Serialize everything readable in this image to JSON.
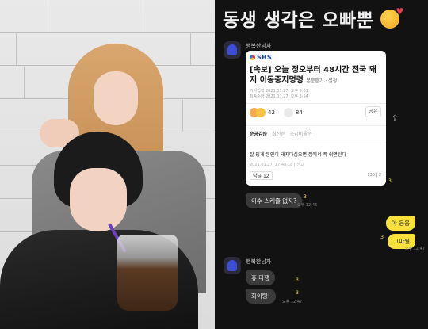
{
  "chat": {
    "title": "동생 생각은 오빠뿐",
    "title_emoji": "smiling-face-with-hearts-icon",
    "sender_name": "행복한남자",
    "card": {
      "logo": "SBS",
      "headline": "[속보] 오늘 정오부터 48시간 전국 돼지 이동중지명령",
      "source_tag": "본문듣기 · 설정",
      "meta_1": "기사입력 2021.01.27. 오후 3:01",
      "meta_2": "최종수정 2021.01.27. 오후 3:54",
      "reaction_1": "42",
      "reaction_2": "84",
      "share_label": "공유",
      "sort_tabs": [
        "순공감순",
        "최신순",
        "공감비율순"
      ],
      "comment": "잘 핑계 본인이 돼지다심으면 집에서 푹 쉬면된다",
      "comment_meta": "2021.01.27. 17:48:18 | 신고",
      "reply_label": "답글 12",
      "votes": "130 | 2"
    },
    "messages": [
      {
        "side": "left",
        "text": "이수 스케쥴 없지?",
        "read": "3",
        "time": "오후 12:46"
      },
      {
        "side": "right",
        "text": "아 응응",
        "read": "",
        "time": ""
      },
      {
        "side": "right",
        "text": "고마웡",
        "read": "3",
        "time": "오후 12:47"
      },
      {
        "side": "left",
        "text": "휴 다행",
        "read": "3",
        "time": ""
      },
      {
        "side": "left",
        "text": "화이팅!",
        "read": "3",
        "time": "오후 12:47"
      }
    ]
  }
}
